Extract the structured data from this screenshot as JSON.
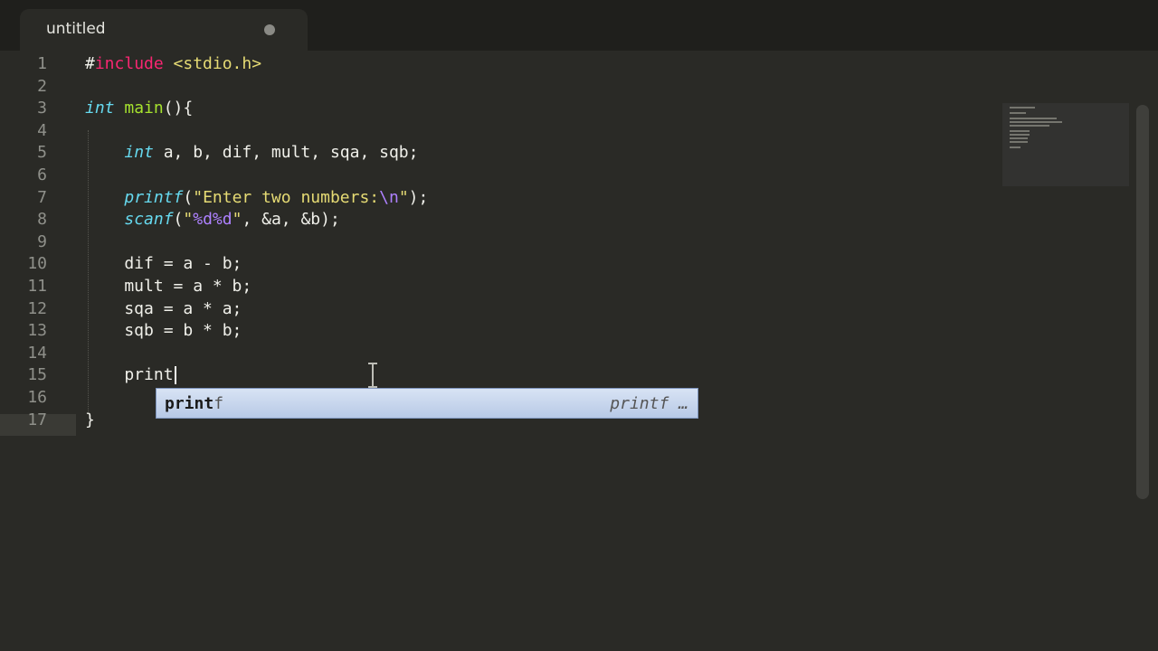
{
  "tab": {
    "title": "untitled"
  },
  "lines": [
    {
      "n": "1",
      "tokens": [
        {
          "t": "#",
          "c": ""
        },
        {
          "t": "include",
          "c": "kw"
        },
        {
          "t": " <stdio.h>",
          "c": "st"
        }
      ]
    },
    {
      "n": "2",
      "tokens": []
    },
    {
      "n": "3",
      "tokens": [
        {
          "t": "int",
          "c": "ty"
        },
        {
          "t": " ",
          "c": ""
        },
        {
          "t": "main",
          "c": "fn"
        },
        {
          "t": "(){",
          "c": ""
        }
      ]
    },
    {
      "n": "4",
      "tokens": []
    },
    {
      "n": "5",
      "tokens": [
        {
          "t": "    ",
          "c": ""
        },
        {
          "t": "int",
          "c": "ty"
        },
        {
          "t": " a, b, dif, mult, sqa, sqb;",
          "c": ""
        }
      ]
    },
    {
      "n": "6",
      "tokens": []
    },
    {
      "n": "7",
      "tokens": [
        {
          "t": "    ",
          "c": ""
        },
        {
          "t": "printf",
          "c": "ty"
        },
        {
          "t": "(",
          "c": ""
        },
        {
          "t": "\"Enter two numbers:",
          "c": "st"
        },
        {
          "t": "\\n",
          "c": "esc"
        },
        {
          "t": "\"",
          "c": "st"
        },
        {
          "t": ");",
          "c": ""
        }
      ]
    },
    {
      "n": "8",
      "tokens": [
        {
          "t": "    ",
          "c": ""
        },
        {
          "t": "scanf",
          "c": "ty"
        },
        {
          "t": "(",
          "c": ""
        },
        {
          "t": "\"",
          "c": "st"
        },
        {
          "t": "%d%d",
          "c": "esc"
        },
        {
          "t": "\"",
          "c": "st"
        },
        {
          "t": ", &a, &b);",
          "c": ""
        }
      ]
    },
    {
      "n": "9",
      "tokens": []
    },
    {
      "n": "10",
      "tokens": [
        {
          "t": "    dif = a - b;",
          "c": ""
        }
      ]
    },
    {
      "n": "11",
      "tokens": [
        {
          "t": "    mult = a * b;",
          "c": ""
        }
      ]
    },
    {
      "n": "12",
      "tokens": [
        {
          "t": "    sqa = a * a;",
          "c": ""
        }
      ]
    },
    {
      "n": "13",
      "tokens": [
        {
          "t": "    sqb = b * b;",
          "c": ""
        }
      ]
    },
    {
      "n": "14",
      "tokens": []
    },
    {
      "n": "15",
      "tokens": [
        {
          "t": "    print",
          "c": ""
        }
      ],
      "caret": true
    },
    {
      "n": "16",
      "tokens": []
    },
    {
      "n": "17",
      "tokens": [
        {
          "t": "}",
          "c": ""
        }
      ]
    }
  ],
  "autocomplete": {
    "match": "print",
    "rest": "f",
    "hint": "printf …"
  }
}
